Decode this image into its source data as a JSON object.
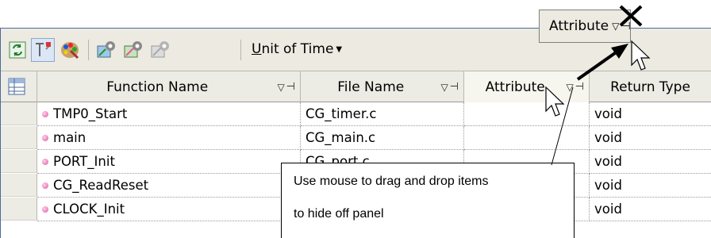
{
  "toolbar": {
    "buttons": [
      {
        "name": "refresh",
        "icon": "refresh-icon"
      },
      {
        "name": "toggle",
        "icon": "toggle-icon",
        "active": true
      },
      {
        "name": "palette",
        "icon": "palette-icon"
      },
      {
        "name": "gear-a",
        "icon": "settings-icon"
      },
      {
        "name": "gear-b",
        "icon": "settings-alt-icon"
      },
      {
        "name": "gear-c",
        "icon": "settings-disabled-icon"
      }
    ],
    "unit_accel": "U",
    "unit_rest": "nit of Time"
  },
  "columns": {
    "function_name": "Function Name",
    "file_name": "File Name",
    "attribute": "Attribute",
    "return_type": "Return Type"
  },
  "rows": [
    {
      "function": "TMP0_Start",
      "file": "CG_timer.c",
      "attribute": "",
      "return": "void"
    },
    {
      "function": "main",
      "file": "CG_main.c",
      "attribute": "",
      "return": "void"
    },
    {
      "function": "PORT_Init",
      "file": "CG_port.c",
      "attribute": "",
      "return": "void"
    },
    {
      "function": "CG_ReadReset",
      "file": "",
      "attribute": "",
      "return": "void"
    },
    {
      "function": "CLOCK_Init",
      "file": "",
      "attribute": "",
      "return": "void"
    }
  ],
  "floating_header": {
    "label": "Attribute"
  },
  "callout": {
    "line1": "Use mouse to drag and drop items",
    "line2": "to hide off panel"
  },
  "colors": {
    "frame": "#4a6a9a",
    "header_bg": "#ecebe4",
    "toolbar_bg": "#eceae1",
    "function_dot": "#e05aa5"
  }
}
